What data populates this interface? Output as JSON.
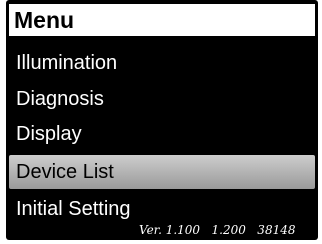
{
  "header": {
    "title": "Menu"
  },
  "menu": {
    "items": [
      {
        "label": "Illumination",
        "selected": false
      },
      {
        "label": "Diagnosis",
        "selected": false
      },
      {
        "label": "Display",
        "selected": false
      },
      {
        "label": "Device List",
        "selected": true
      },
      {
        "label": "Initial Setting",
        "selected": false
      }
    ]
  },
  "footer": {
    "version": "Ver. 1.100   1.200   38148"
  },
  "colors": {
    "background": "#000000",
    "header_bg": "#ffffff",
    "text": "#ffffff",
    "selected_bg": "#b4b4b4",
    "selected_text": "#000000"
  }
}
